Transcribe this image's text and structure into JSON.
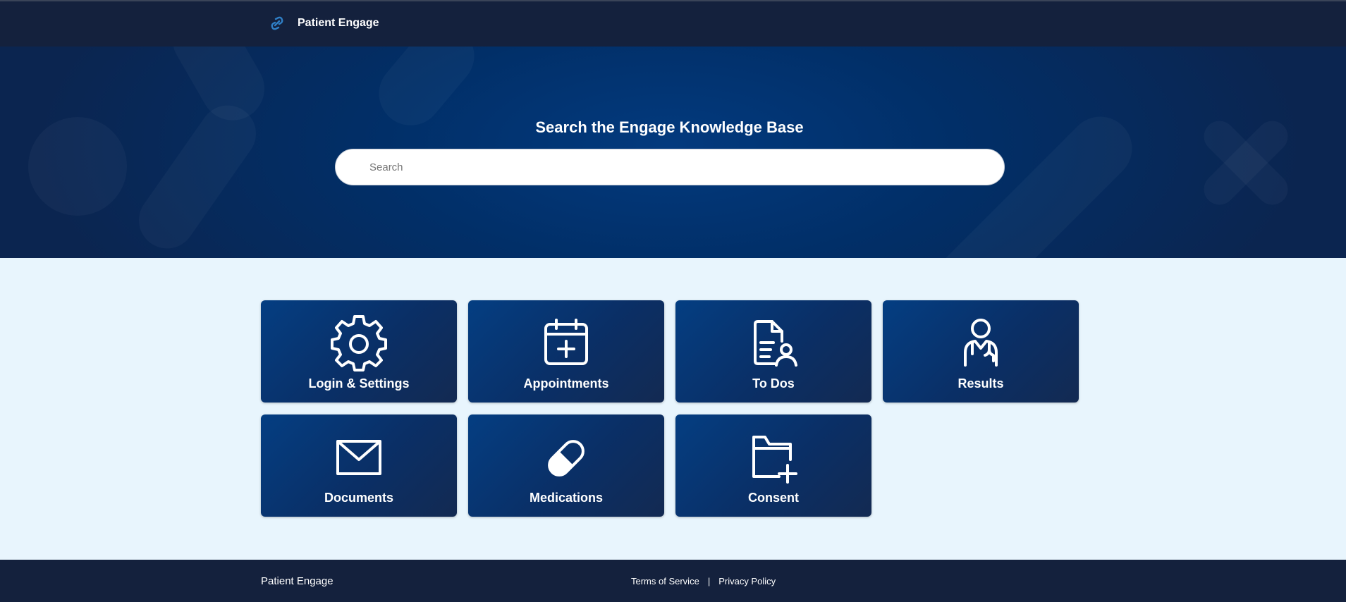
{
  "header": {
    "app_name": "Patient Engage",
    "logo_icon": "link-icon"
  },
  "hero": {
    "title": "Search the Engage Knowledge Base",
    "search_placeholder": "Search"
  },
  "tiles": [
    {
      "label": "Login & Settings",
      "icon": "gear-icon"
    },
    {
      "label": "Appointments",
      "icon": "calendar-plus-icon"
    },
    {
      "label": "To Dos",
      "icon": "document-person-icon"
    },
    {
      "label": "Results",
      "icon": "doctor-icon"
    },
    {
      "label": "Documents",
      "icon": "envelope-icon"
    },
    {
      "label": "Medications",
      "icon": "pill-icon"
    },
    {
      "label": "Consent",
      "icon": "folder-plus-icon"
    }
  ],
  "footer": {
    "brand": "Patient Engage",
    "terms": "Terms of Service",
    "separator": "|",
    "privacy": "Privacy Policy"
  },
  "colors": {
    "topbar": "#14213d",
    "hero_center": "#033a7e",
    "tile_start": "#043e82",
    "tile_end": "#132a52",
    "page_background": "#e8f5fd"
  }
}
